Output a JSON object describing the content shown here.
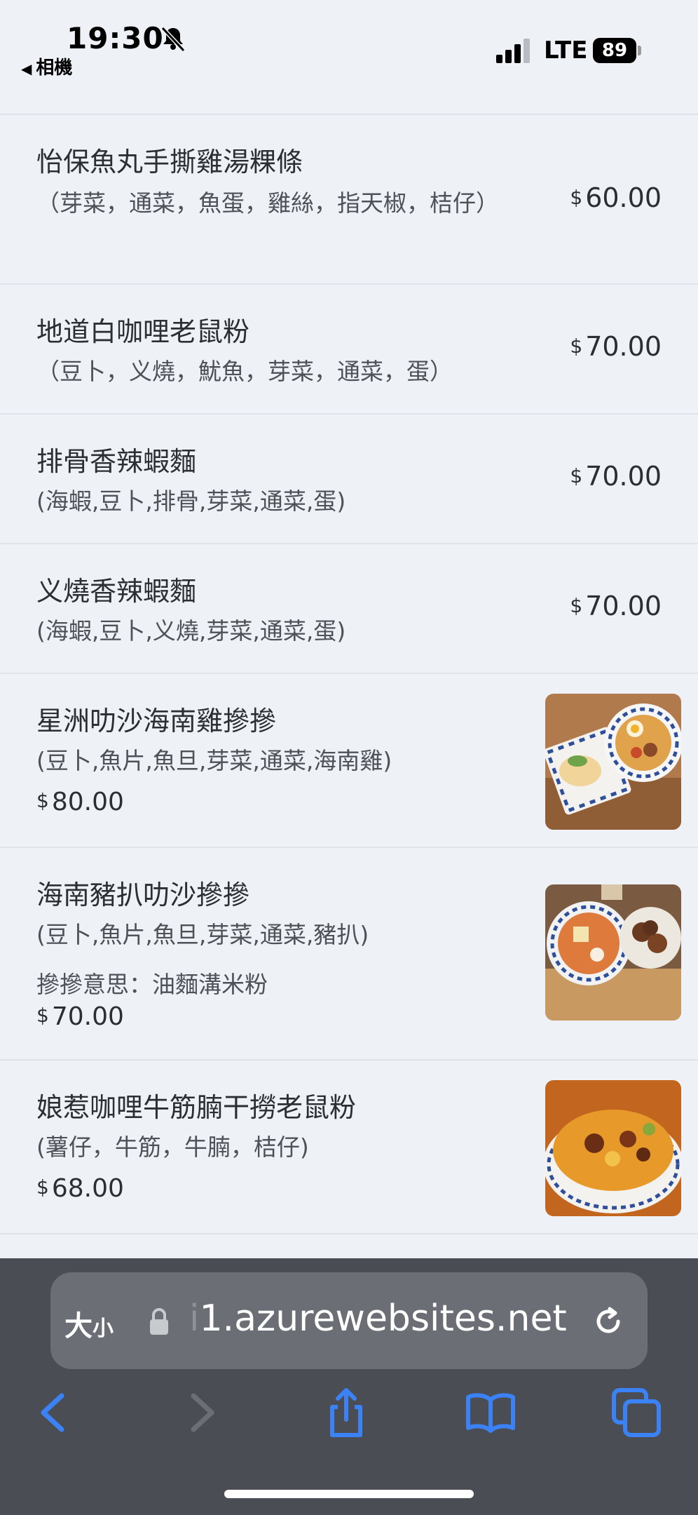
{
  "status": {
    "time": "19:30",
    "back_label": "相機",
    "network": "LTE",
    "battery": "89"
  },
  "menu": {
    "items": [
      {
        "name": "怡保魚丸手撕雞湯粿條",
        "desc": "（芽菜，通菜，魚蛋，雞絲，指天椒，桔仔）",
        "price": "60.00"
      },
      {
        "name": "地道白咖哩老鼠粉",
        "desc": "（豆卜，义燒，魷魚，芽菜，通菜，蛋）",
        "price": "70.00"
      },
      {
        "name": "排骨香辣蝦麵",
        "desc": "(海蝦,豆卜,排骨,芽菜,通菜,蛋)",
        "price": "70.00"
      },
      {
        "name": "义燒香辣蝦麵",
        "desc": "(海蝦,豆卜,义燒,芽菜,通菜,蛋)",
        "price": "70.00"
      },
      {
        "name": "星洲叻沙海南雞摻摻",
        "desc": "(豆卜,魚片,魚旦,芽菜,通菜,海南雞)",
        "price": "80.00",
        "image": "laksa-hainan-chicken"
      },
      {
        "name": "海南豬扒叻沙摻摻",
        "desc": "(豆卜,魚片,魚旦,芽菜,通菜,豬扒)",
        "note": "摻摻意思：油麵溝米粉",
        "price": "70.00",
        "image": "laksa-pork-chop"
      },
      {
        "name": "娘惹咖哩牛筋腩干撈老鼠粉",
        "desc": "(薯仔，牛筋，牛腩，桔仔)",
        "price": "68.00",
        "image": "curry-beef-noodle"
      }
    ],
    "currency": "$"
  },
  "browser": {
    "size_label_big": "大",
    "size_label_small": "小",
    "url_faded": "i",
    "url": "1.azurewebsites.net",
    "accent": "#3b82f6"
  }
}
